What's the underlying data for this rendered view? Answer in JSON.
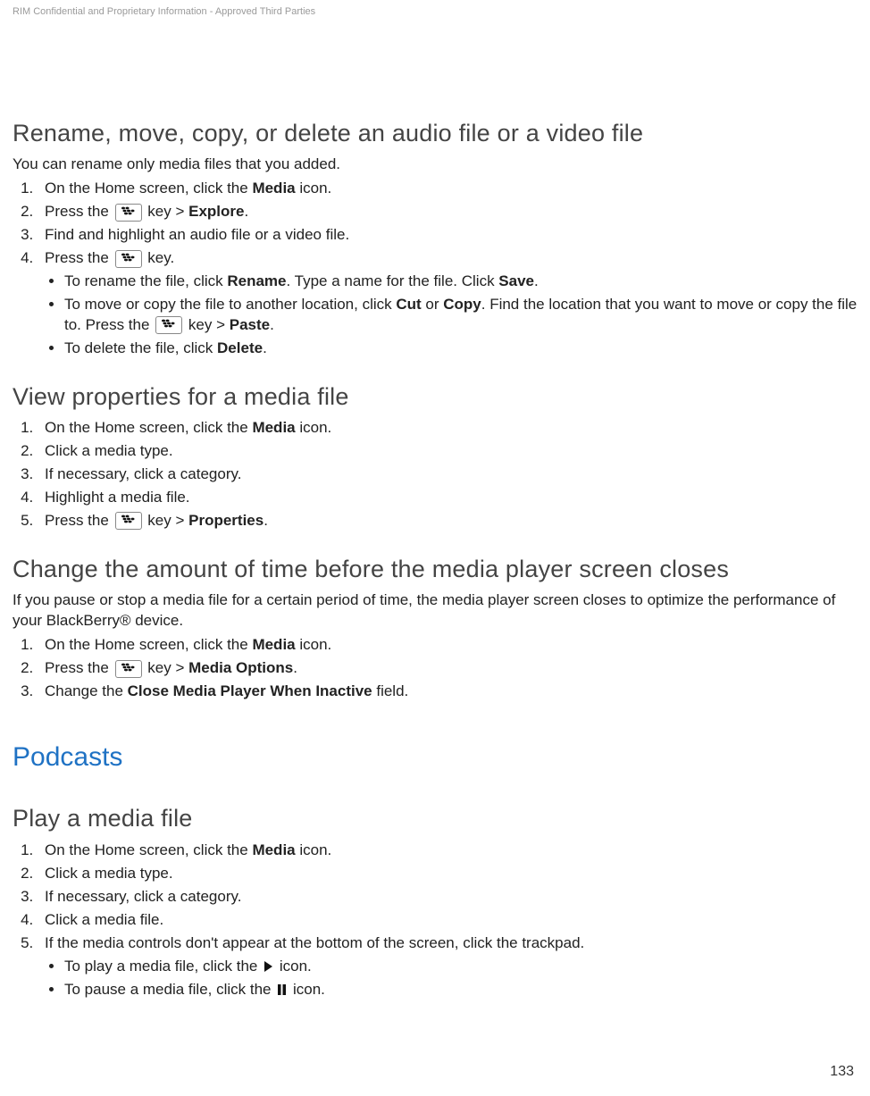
{
  "header": {
    "confidential": "RIM Confidential and Proprietary Information - Approved Third Parties"
  },
  "section1": {
    "title": "Rename, move, copy, or delete an audio file or a video file",
    "intro": "You can rename only media files that you added.",
    "step1_a": "On the Home screen, click the ",
    "step1_b": "Media",
    "step1_c": " icon.",
    "step2_a": "Press the ",
    "step2_b": " key > ",
    "step2_c": "Explore",
    "step2_d": ".",
    "step3": "Find and highlight an audio file or a video file.",
    "step4_a": "Press the ",
    "step4_b": " key.",
    "bullet1_a": "To rename the file, click ",
    "bullet1_b": "Rename",
    "bullet1_c": ". Type a name for the file. Click ",
    "bullet1_d": "Save",
    "bullet1_e": ".",
    "bullet2_a": "To move or copy the file to another location, click ",
    "bullet2_b": "Cut",
    "bullet2_c": " or ",
    "bullet2_d": "Copy",
    "bullet2_e": ". Find the location that you want to move or copy the file to. Press the ",
    "bullet2_f": " key > ",
    "bullet2_g": "Paste",
    "bullet2_h": ".",
    "bullet3_a": "To delete the file, click ",
    "bullet3_b": "Delete",
    "bullet3_c": "."
  },
  "section2": {
    "title": "View properties for a media file",
    "step1_a": "On the Home screen, click the ",
    "step1_b": "Media",
    "step1_c": " icon.",
    "step2": "Click a media type.",
    "step3": "If necessary, click a category.",
    "step4": "Highlight a media file.",
    "step5_a": "Press the ",
    "step5_b": " key > ",
    "step5_c": "Properties",
    "step5_d": "."
  },
  "section3": {
    "title": "Change the amount of time before the media player screen closes",
    "intro": "If you pause or stop a media file for a certain period of time, the media player screen closes to optimize the performance of your BlackBerry® device.",
    "step1_a": "On the Home screen, click the ",
    "step1_b": "Media",
    "step1_c": " icon.",
    "step2_a": "Press the ",
    "step2_b": " key > ",
    "step2_c": "Media Options",
    "step2_d": ".",
    "step3_a": "Change the ",
    "step3_b": "Close Media Player When Inactive",
    "step3_c": " field."
  },
  "podcasts": {
    "title": "Podcasts"
  },
  "section4": {
    "title": "Play a media file",
    "step1_a": "On the Home screen, click the ",
    "step1_b": "Media",
    "step1_c": " icon.",
    "step2": "Click a media type.",
    "step3": "If necessary, click a category.",
    "step4": "Click a media file.",
    "step5": "If the media controls don't appear at the bottom of the screen, click the trackpad.",
    "bullet1_a": "To play a media file, click the ",
    "bullet1_b": " icon.",
    "bullet2_a": "To pause a media file, click the ",
    "bullet2_b": " icon."
  },
  "footer": {
    "pagenum": "133"
  }
}
